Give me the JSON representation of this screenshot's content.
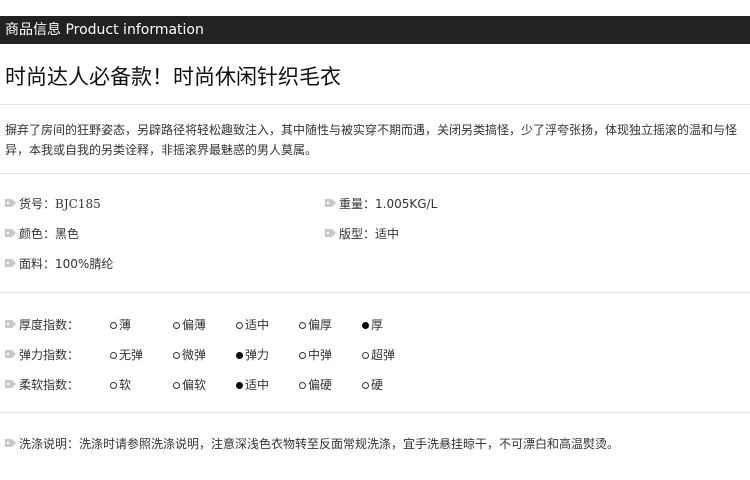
{
  "header": {
    "title": "商品信息 Product information"
  },
  "product": {
    "title": "时尚达人必备款！时尚休闲针织毛衣",
    "intro": "摒弃了房间的狂野姿态，另辟路径将轻松趣致注入，其中随性与被实穿不期而遇，关闭另类搞怪，少了浮夸张扬，体现独立摇滚的温和与怪异，本我或自我的另类诠释，非摇滚界最魅惑的男人莫属。"
  },
  "specs": {
    "sku_label": "货号：",
    "sku_value": "BJC185",
    "weight_label": "重量：",
    "weight_value": "1.005KG/L",
    "color_label": "颜色：",
    "color_value": "黑色",
    "fit_label": "版型：",
    "fit_value": "适中",
    "fabric_label": "面料：",
    "fabric_value": "100%腈纶"
  },
  "indices": [
    {
      "label": "厚度指数：",
      "options": [
        "薄",
        "偏薄",
        "适中",
        "偏厚",
        "厚"
      ],
      "selected": 4
    },
    {
      "label": "弹力指数：",
      "options": [
        "无弹",
        "微弹",
        "弹力",
        "中弹",
        "超弹"
      ],
      "selected": 2
    },
    {
      "label": "柔软指数：",
      "options": [
        "软",
        "偏软",
        "适中",
        "偏硬",
        "硬"
      ],
      "selected": 2
    }
  ],
  "wash": {
    "text": "洗涤说明：洗涤时请参照洗涤说明，注意深浅色衣物转至反面常规洗涤，宜手洗悬挂晾干，不可漂白和高温熨烫。"
  },
  "colors": {
    "header_bg": "#222222",
    "divider": "#e2e2e2",
    "tag_icon": "#c8c8c8"
  }
}
